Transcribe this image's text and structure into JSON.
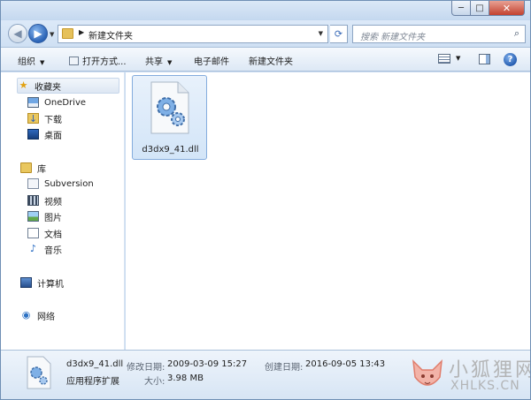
{
  "window": {
    "minimize_glyph": "─",
    "maximize_glyph": "□",
    "close_glyph": "✕"
  },
  "address": {
    "back_glyph": "◀",
    "forward_glyph": "▶",
    "separator": "▶",
    "path": "新建文件夹",
    "refresh_glyph": "⟳",
    "search_placeholder": "搜索 新建文件夹",
    "search_glyph": "⌕"
  },
  "commandbar": {
    "items": [
      {
        "label": "组织",
        "dropdown": true
      },
      {
        "label": "打开方式...",
        "dropdown": false
      },
      {
        "label": "共享",
        "dropdown": true
      },
      {
        "label": "电子邮件",
        "dropdown": false
      },
      {
        "label": "新建文件夹",
        "dropdown": false
      }
    ],
    "dropdown_glyph": "▼",
    "help_glyph": "?"
  },
  "navpane": {
    "favorites": {
      "label": "收藏夹",
      "icon": "star-icon"
    },
    "favorite_items": [
      {
        "label": "OneDrive",
        "icon": "onedrive-icon"
      },
      {
        "label": "下载",
        "icon": "download-icon"
      },
      {
        "label": "桌面",
        "icon": "desktop-icon"
      }
    ],
    "libraries": {
      "label": "库",
      "icon": "library-folder-icon"
    },
    "library_items": [
      {
        "label": "Subversion",
        "icon": "subversion-icon"
      },
      {
        "label": "视频",
        "icon": "video-icon"
      },
      {
        "label": "图片",
        "icon": "picture-icon"
      },
      {
        "label": "文档",
        "icon": "document-icon"
      },
      {
        "label": "音乐",
        "icon": "music-icon"
      }
    ],
    "computer": {
      "label": "计算机",
      "icon": "computer-icon"
    },
    "network": {
      "label": "网络",
      "icon": "network-icon"
    }
  },
  "content": {
    "files": [
      {
        "name": "d3dx9_41.dll",
        "icon": "dll-gear-file-icon",
        "selected": true
      }
    ]
  },
  "details": {
    "filename": "d3dx9_41.dll",
    "filetype": "应用程序扩展",
    "modified_label": "修改日期:",
    "modified_value": "2009-03-09 15:27",
    "size_label": "大小:",
    "size_value": "3.98 MB",
    "created_label": "创建日期:",
    "created_value": "2016-09-05 13:43"
  },
  "watermark": {
    "text_cn": "小狐狸网",
    "text_en": "XHLKS.CN"
  },
  "colors": {
    "frame": "#c9dcf1",
    "accent": "#2a63b6",
    "selection": "#d3e5f8",
    "close": "#c2412f"
  }
}
